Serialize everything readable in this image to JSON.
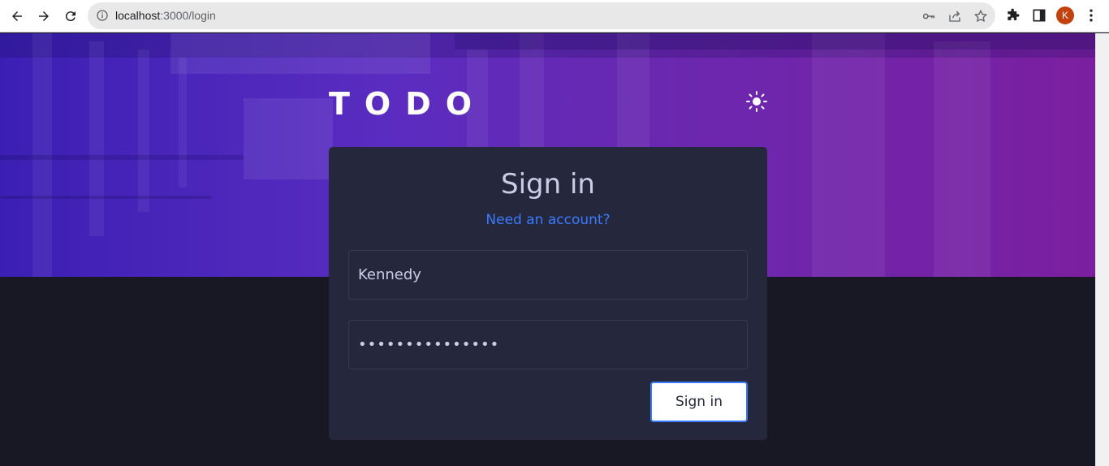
{
  "browser": {
    "url_host": "localhost",
    "url_path": ":3000/login",
    "avatar_initial": "K"
  },
  "icons": {
    "back": "arrow-left-icon",
    "forward": "arrow-right-icon",
    "reload": "reload-icon",
    "site_info": "info-icon",
    "password_key": "key-icon",
    "share": "share-icon",
    "bookmark": "star-icon",
    "extensions": "puzzle-icon",
    "side_panel": "side-panel-icon",
    "menu": "kebab-menu-icon",
    "theme": "sun-icon"
  },
  "colors": {
    "accent": "#3a7bfd",
    "card": "#25273c",
    "page_bg": "#181824",
    "hero_start": "#3b1fb4",
    "hero_end": "#7b1fa0"
  },
  "app": {
    "logo": "TODO"
  },
  "form": {
    "title": "Sign in",
    "switch_link": "Need an account?",
    "username_value": "Kennedy",
    "password_value": "•••••••••••••••",
    "submit_label": "Sign in"
  }
}
